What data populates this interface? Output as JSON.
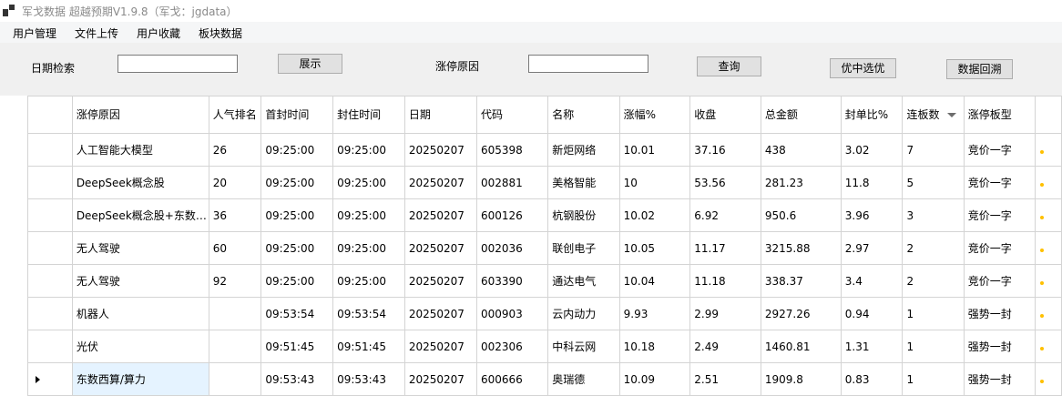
{
  "window": {
    "title": "军戈数据 超越预期V1.9.8（军戈：jgdata）"
  },
  "menu": [
    "用户管理",
    "文件上传",
    "用户收藏",
    "板块数据"
  ],
  "form": {
    "date_label": "日期检索",
    "date_value": "",
    "show_button": "展示",
    "reason_label": "涨停原因",
    "reason_value": "",
    "query_button": "查询",
    "select_button": "优中选优",
    "backtest_button": "数据回溯"
  },
  "table": {
    "columns": [
      "涨停原因",
      "人气排名",
      "首封时间",
      "封住时间",
      "日期",
      "代码",
      "名称",
      "涨幅%",
      "收盘",
      "总金额",
      "封单比%",
      "连板数",
      "涨停板型"
    ],
    "sorted_column": "连板数",
    "rows": [
      [
        "人工智能大模型",
        "26",
        "09:25:00",
        "09:25:00",
        "20250207",
        "605398",
        "新炬网络",
        "10.01",
        "37.16",
        "438",
        "3.02",
        "7",
        "竞价一字"
      ],
      [
        "DeepSeek概念股",
        "20",
        "09:25:00",
        "09:25:00",
        "20250207",
        "002881",
        "美格智能",
        "10",
        "53.56",
        "281.23",
        "11.8",
        "5",
        "竞价一字"
      ],
      [
        "DeepSeek概念股+东数…",
        "36",
        "09:25:00",
        "09:25:00",
        "20250207",
        "600126",
        "杭钢股份",
        "10.02",
        "6.92",
        "950.6",
        "3.96",
        "3",
        "竞价一字"
      ],
      [
        "无人驾驶",
        "60",
        "09:25:00",
        "09:25:00",
        "20250207",
        "002036",
        "联创电子",
        "10.05",
        "11.17",
        "3215.88",
        "2.97",
        "2",
        "竞价一字"
      ],
      [
        "无人驾驶",
        "92",
        "09:25:00",
        "09:25:00",
        "20250207",
        "603390",
        "通达电气",
        "10.04",
        "11.18",
        "338.37",
        "3.4",
        "2",
        "竞价一字"
      ],
      [
        "机器人",
        "",
        "09:53:54",
        "09:53:54",
        "20250207",
        "000903",
        "云内动力",
        "9.93",
        "2.99",
        "2927.26",
        "0.94",
        "1",
        "强势一封"
      ],
      [
        "光伏",
        "",
        "09:51:45",
        "09:51:45",
        "20250207",
        "002306",
        "中科云网",
        "10.18",
        "2.49",
        "1460.81",
        "1.31",
        "1",
        "强势一封"
      ],
      [
        "东数西算/算力",
        "",
        "09:53:43",
        "09:53:43",
        "20250207",
        "600666",
        "奥瑞德",
        "10.09",
        "2.51",
        "1909.8",
        "0.83",
        "1",
        "强势一封"
      ]
    ],
    "selected_row": 7
  },
  "colors": {
    "selected_cell": "#e5f3ff",
    "grid_line": "#d4d4d4",
    "button_face": "#e1e1e1"
  }
}
